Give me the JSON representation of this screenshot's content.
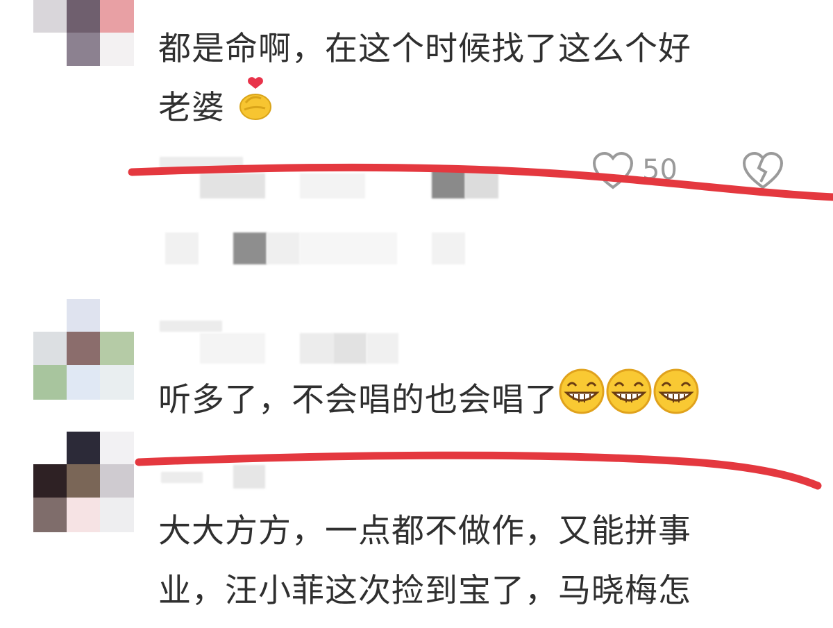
{
  "comments": [
    {
      "line1": "都是命啊，在这个时候找了这么个好",
      "line2": "老婆",
      "emoji": "finger-heart-icon",
      "likes": "50"
    },
    {
      "line1": "听多了，不会唱的也会唱了",
      "emoji": "grinning-face-icon"
    },
    {
      "line1": "大大方方，一点都不做作，又能拼事",
      "line2": "业，汪小菲这次捡到宝了，马晓梅怎"
    }
  ],
  "colors": {
    "annotation_line": "#e4383f",
    "text": "#2f2f2f",
    "meta": "#9a9a9a"
  }
}
